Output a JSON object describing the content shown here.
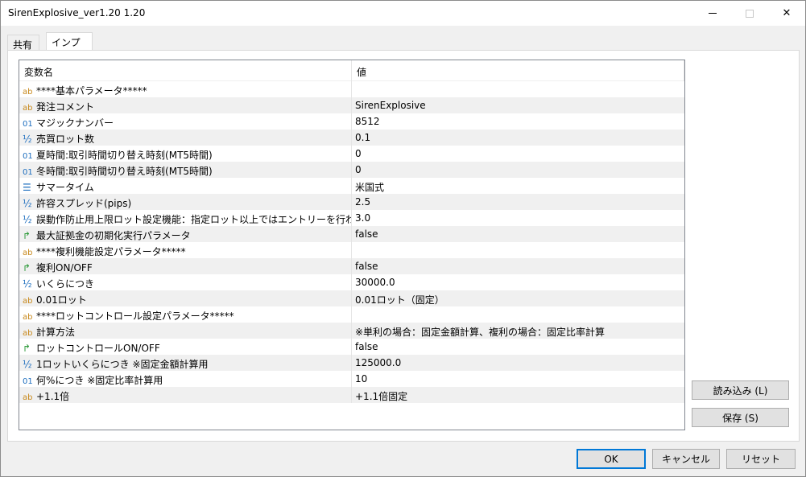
{
  "window": {
    "title": "SirenExplosive_ver1.20 1.20"
  },
  "titlebar": {
    "minimize": "",
    "maximize": "",
    "close": "✕"
  },
  "tabs": [
    {
      "label": "共有"
    },
    {
      "label": "インプット"
    }
  ],
  "grid": {
    "headers": {
      "name": "変数名",
      "value": "値"
    },
    "rows": [
      {
        "icon": "ab",
        "name": "****基本パラメータ*****",
        "value": ""
      },
      {
        "icon": "ab",
        "name": "発注コメント",
        "value": "SirenExplosive"
      },
      {
        "icon": "01",
        "name": "マジックナンバー",
        "value": "8512"
      },
      {
        "icon": "½",
        "name": "売買ロット数",
        "value": "0.1"
      },
      {
        "icon": "01",
        "name": "夏時間:取引時間切り替え時刻(MT5時間)",
        "value": "0"
      },
      {
        "icon": "01",
        "name": "冬時間:取引時間切り替え時刻(MT5時間)",
        "value": "0"
      },
      {
        "icon": "enum",
        "name": "サマータイム",
        "value": "米国式"
      },
      {
        "icon": "½",
        "name": "許容スプレッド(pips)",
        "value": "2.5"
      },
      {
        "icon": "½",
        "name": "誤動作防止用上限ロット設定機能：指定ロット以上ではエントリーを行わない。",
        "value": "3.0"
      },
      {
        "icon": "bool",
        "name": "最大証拠金の初期化実行パラメータ",
        "value": "false"
      },
      {
        "icon": "ab",
        "name": "****複利機能設定パラメータ*****",
        "value": ""
      },
      {
        "icon": "bool",
        "name": "複利ON/OFF",
        "value": "false"
      },
      {
        "icon": "½",
        "name": "いくらにつき",
        "value": "30000.0"
      },
      {
        "icon": "ab",
        "name": "0.01ロット",
        "value": "0.01ロット（固定）"
      },
      {
        "icon": "ab",
        "name": "****ロットコントロール設定パラメータ*****",
        "value": ""
      },
      {
        "icon": "ab",
        "name": "計算方法",
        "value": "※単利の場合：固定金額計算、複利の場合：固定比率計算"
      },
      {
        "icon": "bool",
        "name": "ロットコントロールON/OFF",
        "value": "false"
      },
      {
        "icon": "½",
        "name": "1ロットいくらにつき ※固定金額計算用",
        "value": "125000.0"
      },
      {
        "icon": "01",
        "name": "何%につき ※固定比率計算用",
        "value": "10"
      },
      {
        "icon": "ab",
        "name": "+1.1倍",
        "value": "+1.1倍固定"
      }
    ]
  },
  "buttons": {
    "load": "読み込み (L)",
    "save": "保存 (S)",
    "ok": "OK",
    "cancel": "キャンセル",
    "reset": "リセット"
  }
}
